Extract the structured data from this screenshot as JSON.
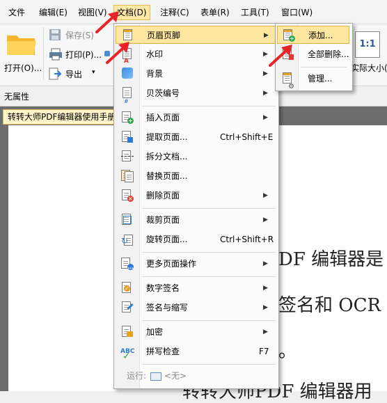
{
  "menubar": {
    "items": [
      "文件",
      "编辑(E)",
      "视图(V)",
      "文档(D)",
      "注释(C)",
      "表单(R)",
      "工具(T)",
      "窗口(W)"
    ],
    "active_index": 3
  },
  "ribbon": {
    "open_label": "打开(O)...",
    "save_label": "保存(S)",
    "print_label": "打印(P)...",
    "export_label": "导出",
    "actual_size_label": "实际大小(A",
    "actual_size_icon_text": "1:1"
  },
  "props": {
    "label": "无属性"
  },
  "doc": {
    "tab_title": "转转大师PDF编辑器使用手册",
    "lines": [
      "DF 编辑器是",
      "签名和 OCR 等",
      "。",
      "转转大师PDF 编辑器用"
    ]
  },
  "menu_document": {
    "items": [
      {
        "label": "页眉页脚",
        "shortcut": "",
        "submenu": true
      },
      {
        "label": "水印",
        "shortcut": "",
        "submenu": true
      },
      {
        "label": "背景",
        "shortcut": "",
        "submenu": true
      },
      {
        "label": "贝茨编号",
        "shortcut": "",
        "submenu": true
      },
      {
        "label": "插入页面",
        "shortcut": "",
        "submenu": true
      },
      {
        "label": "提取页面...",
        "shortcut": "Ctrl+Shift+E",
        "submenu": false
      },
      {
        "label": "拆分文档...",
        "shortcut": "",
        "submenu": false
      },
      {
        "label": "替换页面...",
        "shortcut": "",
        "submenu": false
      },
      {
        "label": "删除页面",
        "shortcut": "",
        "submenu": true
      },
      {
        "label": "裁剪页面",
        "shortcut": "",
        "submenu": true
      },
      {
        "label": "旋转页面...",
        "shortcut": "Ctrl+Shift+R",
        "submenu": false
      },
      {
        "label": "更多页面操作",
        "shortcut": "",
        "submenu": true
      },
      {
        "label": "数字签名",
        "shortcut": "",
        "submenu": true
      },
      {
        "label": "签名与缩写",
        "shortcut": "",
        "submenu": true
      },
      {
        "label": "加密",
        "shortcut": "",
        "submenu": true
      },
      {
        "label": "拼写检查",
        "shortcut": "F7",
        "submenu": false
      }
    ],
    "run_label": "运行:",
    "run_value": "<无>",
    "spell_icon_text": "ABC"
  },
  "menu_headerfooter": {
    "items": [
      "添加...",
      "全部删除...",
      "管理..."
    ]
  },
  "colors": {
    "highlight": "#ffe7a0",
    "highlight_border": "#e3b342",
    "arrow": "#e8232a"
  }
}
